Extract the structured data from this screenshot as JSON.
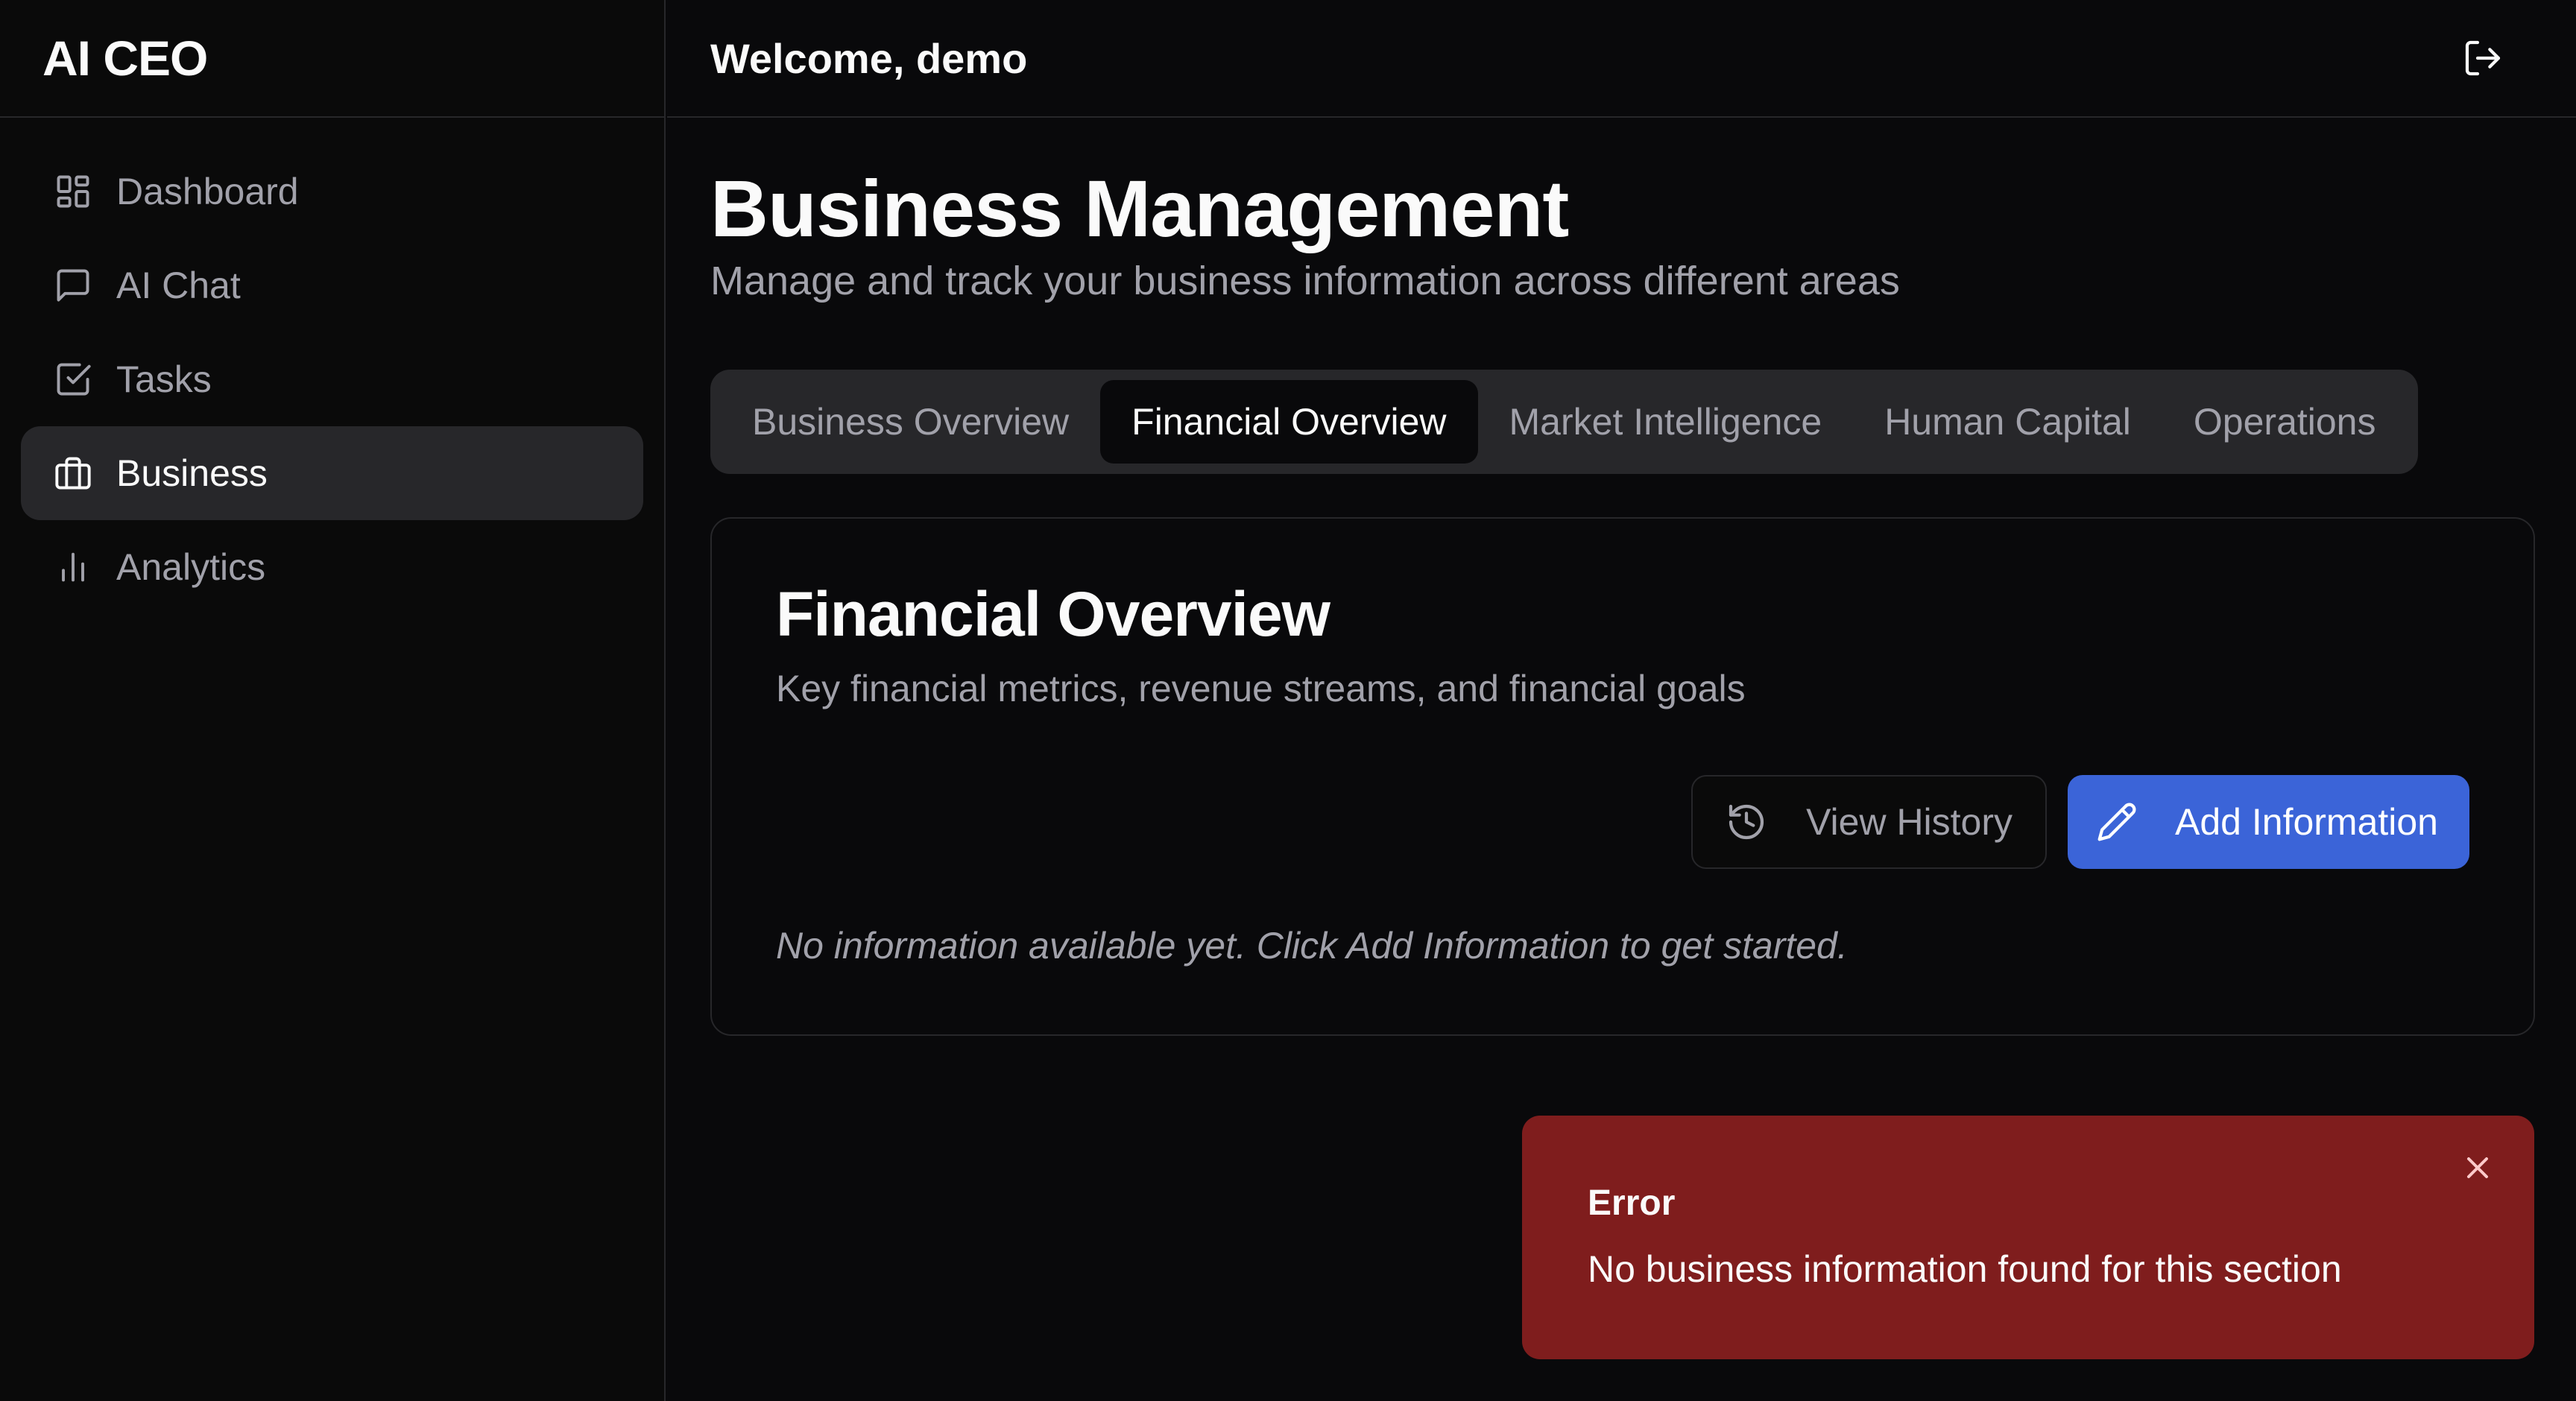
{
  "brand": "AI CEO",
  "header": {
    "welcome": "Welcome, demo",
    "logout_icon": "log-out-icon"
  },
  "sidebar": {
    "items": [
      {
        "label": "Dashboard",
        "icon": "layout-dashboard-icon",
        "active": false
      },
      {
        "label": "AI Chat",
        "icon": "message-square-icon",
        "active": false
      },
      {
        "label": "Tasks",
        "icon": "check-square-icon",
        "active": false
      },
      {
        "label": "Business",
        "icon": "briefcase-icon",
        "active": true
      },
      {
        "label": "Analytics",
        "icon": "bar-chart-icon",
        "active": false
      }
    ]
  },
  "main": {
    "title": "Business Management",
    "subtitle": "Manage and track your business information across different areas",
    "tabs": [
      {
        "label": "Business Overview",
        "active": false
      },
      {
        "label": "Financial Overview",
        "active": true
      },
      {
        "label": "Market Intelligence",
        "active": false
      },
      {
        "label": "Human Capital",
        "active": false
      },
      {
        "label": "Operations",
        "active": false
      }
    ],
    "card": {
      "title": "Financial Overview",
      "description": "Key financial metrics, revenue streams, and financial goals",
      "view_history_label": "View History",
      "add_information_label": "Add Information",
      "empty_message": "No information available yet. Click Add Information to get started."
    }
  },
  "toast": {
    "title": "Error",
    "message": "No business information found for this section"
  },
  "colors": {
    "background": "#09090b",
    "accent": "#3b64d8",
    "error": "#7f1d1d",
    "muted_text": "#a1a1aa"
  }
}
